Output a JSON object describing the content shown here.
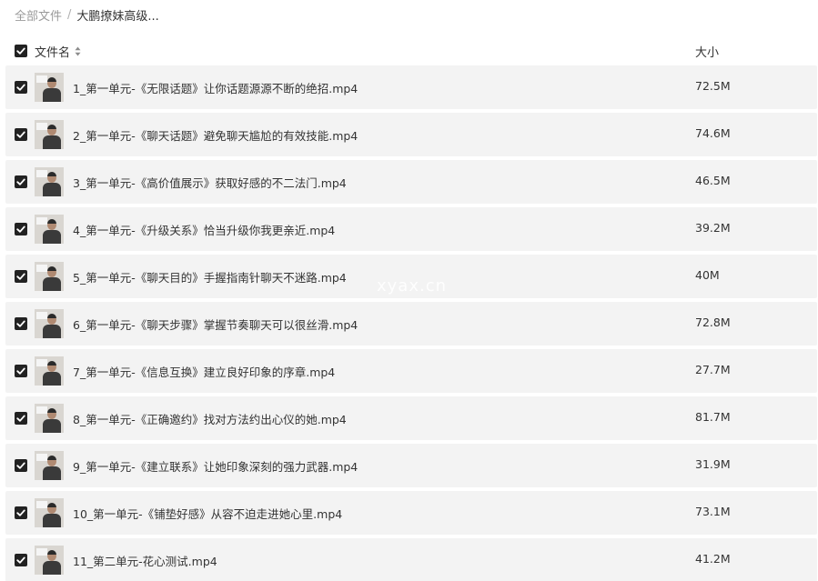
{
  "breadcrumb": {
    "root": "全部文件",
    "separator": "/",
    "current": "大鹏撩妹高级..."
  },
  "header": {
    "name_label": "文件名",
    "size_label": "大小",
    "select_all_checked": true,
    "sort_icon": "sort-icon"
  },
  "files": [
    {
      "name": "1_第一单元-《无限话题》让你话题源源不断的绝招.mp4",
      "size": "72.5M",
      "checked": true
    },
    {
      "name": "2_第一单元-《聊天话题》避免聊天尴尬的有效技能.mp4",
      "size": "74.6M",
      "checked": true
    },
    {
      "name": "3_第一单元-《高价值展示》获取好感的不二法门.mp4",
      "size": "46.5M",
      "checked": true
    },
    {
      "name": "4_第一单元-《升级关系》恰当升级你我更亲近.mp4",
      "size": "39.2M",
      "checked": true
    },
    {
      "name": "5_第一单元-《聊天目的》手握指南针聊天不迷路.mp4",
      "size": "40M",
      "checked": true
    },
    {
      "name": "6_第一单元-《聊天步骤》掌握节奏聊天可以很丝滑.mp4",
      "size": "72.8M",
      "checked": true
    },
    {
      "name": "7_第一单元-《信息互换》建立良好印象的序章.mp4",
      "size": "27.7M",
      "checked": true
    },
    {
      "name": "8_第一单元-《正确邀约》找对方法约出心仪的她.mp4",
      "size": "81.7M",
      "checked": true
    },
    {
      "name": "9_第一单元-《建立联系》让她印象深刻的强力武器.mp4",
      "size": "31.9M",
      "checked": true
    },
    {
      "name": "10_第一单元-《铺垫好感》从容不迫走进她心里.mp4",
      "size": "73.1M",
      "checked": true
    },
    {
      "name": "11_第二单元-花心测试.mp4",
      "size": "41.2M",
      "checked": true
    }
  ],
  "watermark": "xyax.cn",
  "colors": {
    "row_background": "#f3f3f3",
    "checkbox": "#222222",
    "text": "#333333",
    "breadcrumb_muted": "#9a9a9a"
  }
}
